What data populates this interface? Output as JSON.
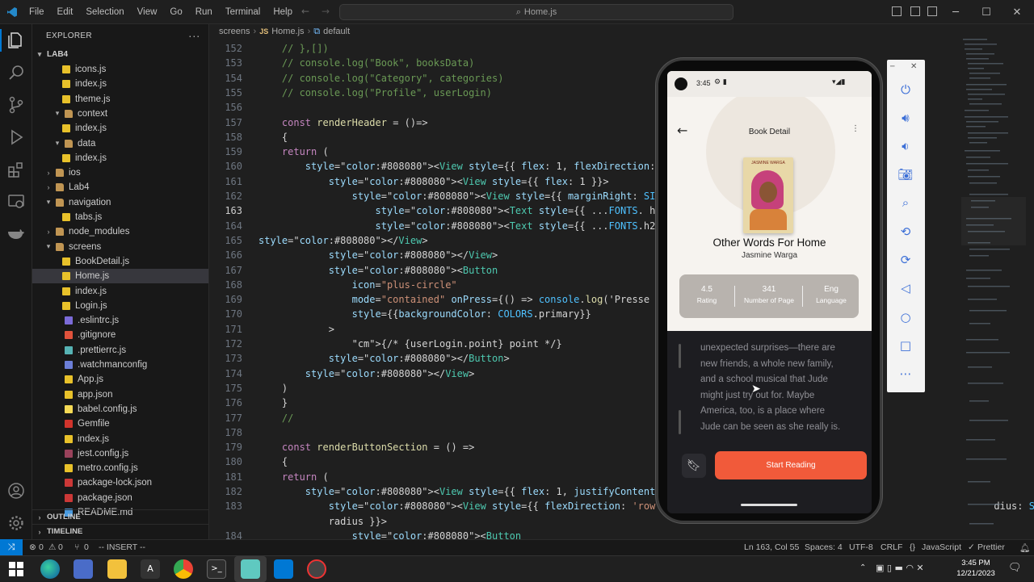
{
  "menu": [
    "File",
    "Edit",
    "Selection",
    "View",
    "Go",
    "Run",
    "Terminal",
    "Help"
  ],
  "command_center": "Home.js",
  "sidebar": {
    "title": "EXPLORER",
    "project": "LAB4",
    "items": [
      {
        "label": "icons.js",
        "indent": 3,
        "type": "js"
      },
      {
        "label": "index.js",
        "indent": 3,
        "type": "js"
      },
      {
        "label": "theme.js",
        "indent": 3,
        "type": "js"
      },
      {
        "label": "context",
        "indent": 2,
        "type": "folder",
        "open": true
      },
      {
        "label": "index.js",
        "indent": 3,
        "type": "js"
      },
      {
        "label": "data",
        "indent": 2,
        "type": "folder",
        "open": true
      },
      {
        "label": "index.js",
        "indent": 3,
        "type": "js"
      },
      {
        "label": "ios",
        "indent": 1,
        "type": "folder",
        "open": false
      },
      {
        "label": "Lab4",
        "indent": 1,
        "type": "folder",
        "open": false
      },
      {
        "label": "navigation",
        "indent": 1,
        "type": "folder",
        "open": true
      },
      {
        "label": "tabs.js",
        "indent": 3,
        "type": "js"
      },
      {
        "label": "node_modules",
        "indent": 1,
        "type": "folder",
        "open": false
      },
      {
        "label": "screens",
        "indent": 1,
        "type": "folder",
        "open": true
      },
      {
        "label": "BookDetail.js",
        "indent": 3,
        "type": "js"
      },
      {
        "label": "Home.js",
        "indent": 3,
        "type": "js",
        "selected": true
      },
      {
        "label": "index.js",
        "indent": 3,
        "type": "js"
      },
      {
        "label": "Login.js",
        "indent": 3,
        "type": "js"
      },
      {
        "label": ".eslintrc.js",
        "indent": 2,
        "type": "eslint"
      },
      {
        "label": ".gitignore",
        "indent": 2,
        "type": "git"
      },
      {
        "label": ".prettierrc.js",
        "indent": 2,
        "type": "prettier"
      },
      {
        "label": ".watchmanconfig",
        "indent": 2,
        "type": "watchman"
      },
      {
        "label": "App.js",
        "indent": 2,
        "type": "js"
      },
      {
        "label": "app.json",
        "indent": 2,
        "type": "json"
      },
      {
        "label": "babel.config.js",
        "indent": 2,
        "type": "babel"
      },
      {
        "label": "Gemfile",
        "indent": 2,
        "type": "gem"
      },
      {
        "label": "index.js",
        "indent": 2,
        "type": "js"
      },
      {
        "label": "jest.config.js",
        "indent": 2,
        "type": "jest"
      },
      {
        "label": "metro.config.js",
        "indent": 2,
        "type": "js"
      },
      {
        "label": "package-lock.json",
        "indent": 2,
        "type": "npm"
      },
      {
        "label": "package.json",
        "indent": 2,
        "type": "npm"
      },
      {
        "label": "README.md",
        "indent": 2,
        "type": "info"
      }
    ],
    "outline": "OUTLINE",
    "timeline": "TIMELINE"
  },
  "breadcrumb": [
    "screens",
    "Home.js",
    "default"
  ],
  "code": [
    {
      "n": "152",
      "t": "    // },[])"
    },
    {
      "n": "153",
      "t": "    // console.log(\"Book\", booksData)"
    },
    {
      "n": "154",
      "t": "    // console.log(\"Category\", categories)"
    },
    {
      "n": "155",
      "t": "    // console.log(\"Profile\", userLogin)"
    },
    {
      "n": "156",
      "t": ""
    },
    {
      "n": "157",
      "t": "    const renderHeader = ()=>"
    },
    {
      "n": "158",
      "t": "    {"
    },
    {
      "n": "159",
      "t": "    return ("
    },
    {
      "n": "160",
      "t": "        <View style={{ flex: 1, flexDirection: 'row', paddingHorizo"
    },
    {
      "n": "161",
      "t": "            <View style={{ flex: 1 }}>"
    },
    {
      "n": "162",
      "t": "                <View style={{ marginRight: SIZES.padding }}>"
    },
    {
      "n": "163",
      "t": "                    <Text style={{ ...FONTS. h3, color: COLORS.white"
    },
    {
      "n": "164",
      "t": "                    <Text style={{ ...FONTS.h2, color: COLORS.white"
    },
    {
      "n": "165",
      "t": "</View>"
    },
    {
      "n": "166",
      "t": "            </View>"
    },
    {
      "n": "167",
      "t": "            <Button"
    },
    {
      "n": "168",
      "t": "                icon=\"plus-circle\""
    },
    {
      "n": "169",
      "t": "                mode=\"contained\" onPress={() => console.log('Presse"
    },
    {
      "n": "170",
      "t": "                style={{backgroundColor: COLORS.primary}}"
    },
    {
      "n": "171",
      "t": "            >"
    },
    {
      "n": "172",
      "t": "                {/* {userLogin.point} point */}"
    },
    {
      "n": "173",
      "t": "            </Button>"
    },
    {
      "n": "174",
      "t": "        </View>"
    },
    {
      "n": "175",
      "t": "    )"
    },
    {
      "n": "176",
      "t": "    }"
    },
    {
      "n": "177",
      "t": "    //"
    },
    {
      "n": "178",
      "t": ""
    },
    {
      "n": "179",
      "t": "    const renderButtonSection = () =>"
    },
    {
      "n": "180",
      "t": "    {"
    },
    {
      "n": "181",
      "t": "    return ("
    },
    {
      "n": "182",
      "t": "        <View style={{ flex: 1, justifyContent: 'center', padding: "
    },
    {
      "n": "183",
      "t": "            <View style={{ flexDirection: 'row', height: 70, backgro                                    dius: SIZES."
    },
    {
      "n": "",
      "t": "            radius }}>"
    },
    {
      "n": "184",
      "t": "                <Button"
    }
  ],
  "status": {
    "errors": "0",
    "warnings": "0",
    "mode": "-- INSERT --",
    "position": "Ln 163, Col 55",
    "spaces": "Spaces: 4",
    "encoding": "UTF-8",
    "eol": "CRLF",
    "language": "JavaScript",
    "formatter": "Prettier"
  },
  "phone": {
    "time": "3:45",
    "header_title": "Book Detail",
    "book_title": "Other Words For Home",
    "author": "Jasmine Warga",
    "cover_author": "JASMINE WARGA",
    "stats": [
      {
        "value": "4.5",
        "label": "Rating"
      },
      {
        "value": "341",
        "label": "Number of Page"
      },
      {
        "value": "Eng",
        "label": "Language"
      }
    ],
    "description_lines": [
      "unexpected surprises—there are",
      "new friends, a whole new family,",
      "and a school musical that Jude",
      "might just try out for. Maybe",
      "America, too, is a place where",
      "Jude can be seen as she really is."
    ],
    "cta": "Start Reading"
  },
  "taskbar": {
    "time": "3:45 PM",
    "date": "12/21/2023"
  },
  "colors": {
    "accent": "#f15a3a",
    "vscode_blue": "#0078d4",
    "status_bg": "#181818"
  }
}
